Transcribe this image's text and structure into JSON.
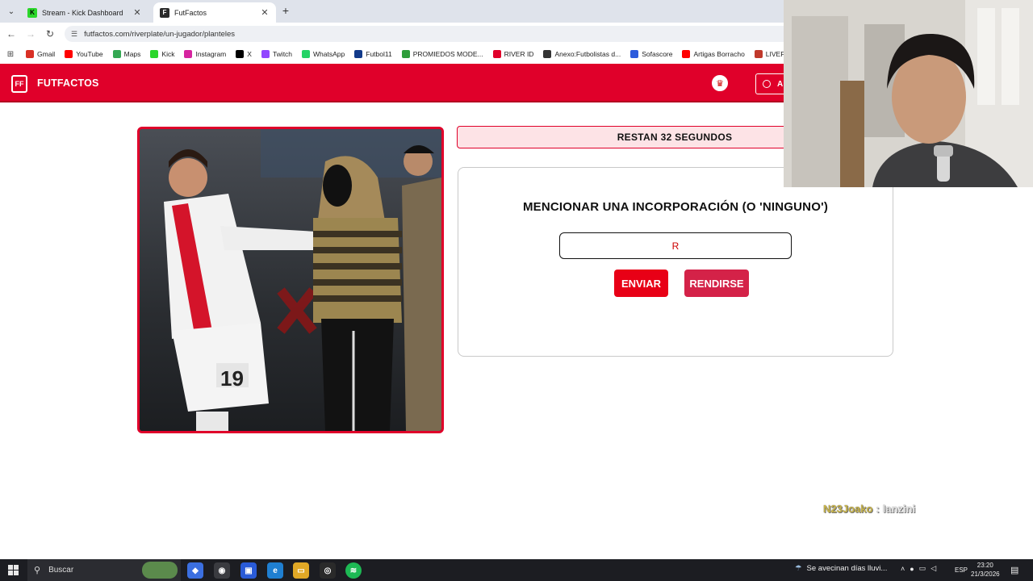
{
  "browser": {
    "tabs": [
      {
        "label": "Stream - Kick Dashboard",
        "icon": "kick-icon"
      },
      {
        "label": "FutFactos",
        "icon": "futfactos-icon"
      }
    ],
    "url": "futfactos.com/riverplate/un-jugador/planteles",
    "bookmarks": [
      {
        "label": "Gmail",
        "color": "#d93025"
      },
      {
        "label": "YouTube",
        "color": "#ff0000"
      },
      {
        "label": "Maps",
        "color": "#34a853"
      },
      {
        "label": "Kick",
        "color": "#2bd62b"
      },
      {
        "label": "Instagram",
        "color": "#d6249f"
      },
      {
        "label": "X",
        "color": "#000000"
      },
      {
        "label": "Twitch",
        "color": "#9146ff"
      },
      {
        "label": "WhatsApp",
        "color": "#25d366"
      },
      {
        "label": "Futbol11",
        "color": "#123a8a"
      },
      {
        "label": "PROMIEDOS MODE...",
        "color": "#2e9d3a"
      },
      {
        "label": "RIVER ID",
        "color": "#e0002a"
      },
      {
        "label": "Anexo:Futbolistas d...",
        "color": "#333333"
      },
      {
        "label": "Sofascore",
        "color": "#2c5bdc"
      },
      {
        "label": "Artigas Borracho",
        "color": "#ff0000"
      },
      {
        "label": "LIVEFUTBOL",
        "color": "#c0392b"
      }
    ]
  },
  "site": {
    "logo_text": "FUTFACTOS",
    "logo_mark": "FF",
    "header_button": "A",
    "brand_color": "#e0002a"
  },
  "game": {
    "timer": "RESTAN 32 SEGUNDOS",
    "question": "MENCIONAR UNA INCORPORACIÓN (O 'NINGUNO')",
    "input_value": "R",
    "send_label": "ENVIAR",
    "surrender_label": "RENDIRSE"
  },
  "chat": {
    "user": "N23Joako",
    "separator": ":",
    "message": "lanzini"
  },
  "taskbar": {
    "search_placeholder": "Buscar",
    "weather_text": "Se avecinan días lluvi...",
    "language": "ESP",
    "time": "23:20",
    "date": "21/3/2026"
  }
}
